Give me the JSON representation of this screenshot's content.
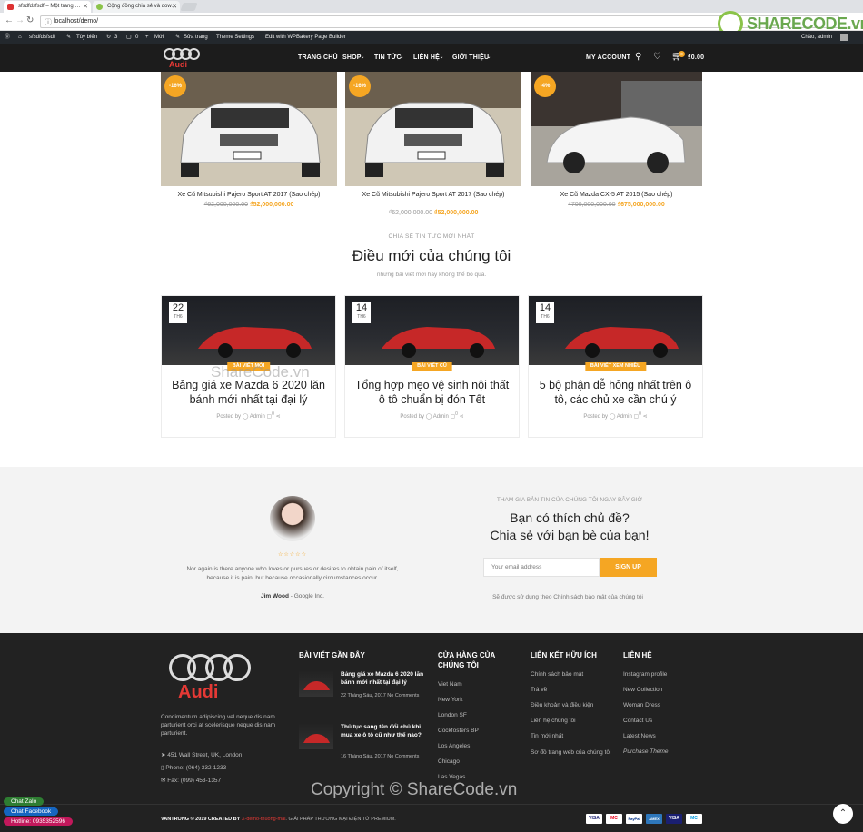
{
  "browser": {
    "tabs": [
      {
        "title": "sfsdfdsfsdf – Một trang …"
      },
      {
        "title": "Cộng đồng chia sẻ và dow…"
      }
    ],
    "url": "localhost/demo/"
  },
  "admin_bar": {
    "site_name": "sfsdfdsfsdf",
    "customize": "Tùy biến",
    "updates": "3",
    "comments": "0",
    "new": "Mới",
    "edit": "Sửa trang",
    "theme_settings": "Theme Settings",
    "wpbakery": "Edit with WPBakery Page Builder",
    "greeting": "Chào, admin"
  },
  "header": {
    "logo_text": "Audi",
    "menu": [
      "TRANG CHỦ",
      "SHOP",
      "TIN TỨC",
      "LIÊN HỆ",
      "GIỚI THIỆU"
    ],
    "my_account": "MY ACCOUNT",
    "cart_count": "0",
    "cart_total": "₫0.00"
  },
  "products": [
    {
      "badge": "-16%",
      "title": "Xe Cũ Mitsubishi Pajero Sport AT 2017 (Sao chép)",
      "old_price": "₫62,000,000.00",
      "new_price": "₫52,000,000.00"
    },
    {
      "badge": "-16%",
      "title": "Xe Cũ Mitsubishi Pajero Sport AT 2017 (Sao chép)",
      "old_price": "₫62,000,000.00",
      "new_price": "₫52,000,000.00"
    },
    {
      "badge": "-4%",
      "title": "Xe Cũ Mazda CX-5 AT 2015 (Sao chép)",
      "old_price": "₫700,000,000.00",
      "new_price": "₫675,000,000.00"
    }
  ],
  "news_section": {
    "eyebrow": "CHIA SẺ TIN TỨC MỚI NHẤT",
    "title": "Điều mới của chúng tôi",
    "subtitle": "những bài viết mới hay không thể bỏ qua."
  },
  "posts": [
    {
      "day": "22",
      "month": "TH6",
      "category": "BÀI VIẾT MỚI",
      "title": "Bảng giá xe Mazda 6 2020 lăn bánh mới nhất tại đại lý",
      "posted_by": "Posted by",
      "author": "Admin",
      "comments": "0"
    },
    {
      "day": "14",
      "month": "TH6",
      "category": "BÀI VIẾT CŨ",
      "title": "Tổng hợp mẹo vệ sinh nội thất ô tô chuẩn bị đón Tết",
      "posted_by": "Posted by",
      "author": "Admin",
      "comments": "0"
    },
    {
      "day": "14",
      "month": "TH6",
      "category": "BÀI VIẾT XEM NHIỀU",
      "title": "5 bộ phận dễ hỏng nhất trên ô tô, các chủ xe cần chú ý",
      "posted_by": "Posted by",
      "author": "Admin",
      "comments": "0"
    }
  ],
  "watermark_mid": "ShareCode.vn",
  "testimonial": {
    "stars": "☆☆☆☆☆",
    "text": "Nor again is there anyone who loves or pursues or desires to obtain pain of itself, because it is pain, but because occasionally circumstances occur.",
    "name": "Jim Wood",
    "company": "- Google Inc."
  },
  "newsletter": {
    "eyebrow": "THAM GIA BẢN TIN CỦA CHÚNG TÔI NGAY BÂY GIỜ",
    "title_line1": "Bạn có thích chủ đề?",
    "title_line2": "Chia sẻ với bạn bè của bạn!",
    "placeholder": "Your email address",
    "button": "SIGN UP",
    "note": "Sẽ được sử dụng theo Chính sách bảo mật của chúng tôi"
  },
  "footer": {
    "about": "Condimentum adipiscing vel neque dis nam parturient orci at scelerisque neque dis nam parturient.",
    "address": "451 Wall Street, UK, London",
    "phone": "Phone: (064) 332-1233",
    "fax": "Fax: (099) 453-1357",
    "recent_title": "BÀI VIẾT GẦN ĐÂY",
    "recent": [
      {
        "title": "Bảng giá xe Mazda 6 2020 lăn bánh mới nhất tại đại lý",
        "date": "22 Tháng Sáu, 2017",
        "comments": "No Comments"
      },
      {
        "title": "Thủ tục sang tên đổi chủ khi mua xe ô tô cũ như thế nào?",
        "date": "16 Tháng Sáu, 2017",
        "comments": "No Comments"
      }
    ],
    "stores_title": "CỬA HÀNG CỦA CHÚNG TÔI",
    "stores": [
      "Viet Nam",
      "New York",
      "London SF",
      "Cockfosters BP",
      "Los Angeles",
      "Chicago",
      "Las Vegas"
    ],
    "links_title": "LIÊN KẾT HỮU ÍCH",
    "links": [
      "Chính sách bảo mật",
      "Trả về",
      "Điều khoản và điều kiện",
      "Liên hệ chúng tôi",
      "Tin mới nhất",
      "Sơ đồ trang web của chúng tôi"
    ],
    "contact_title": "LIÊN HỆ",
    "contact": [
      "Instagram profile",
      "New Collection",
      "Woman Dress",
      "Contact Us",
      "Latest News",
      "Purchase Theme"
    ],
    "copyright_left": "VANTRONG © 2019 CREATED BY",
    "copyright_brand": "X-demo-thuong-mai",
    "copyright_right": ". GIẢI PHÁP THƯƠNG MẠI ĐIỆN TỬ PREMIUM.",
    "watermark": "Copyright © ShareCode.vn",
    "payments": [
      "VISA",
      "MC",
      "PayPal",
      "AMEX",
      "VISA",
      "MC"
    ]
  },
  "floating": {
    "chat_zalo": "Chat Zalo",
    "chat_facebook": "Chat Facebook",
    "hotline": "Hotline: 0935352596"
  },
  "sharecode_logo": "SHARECODE.vn"
}
